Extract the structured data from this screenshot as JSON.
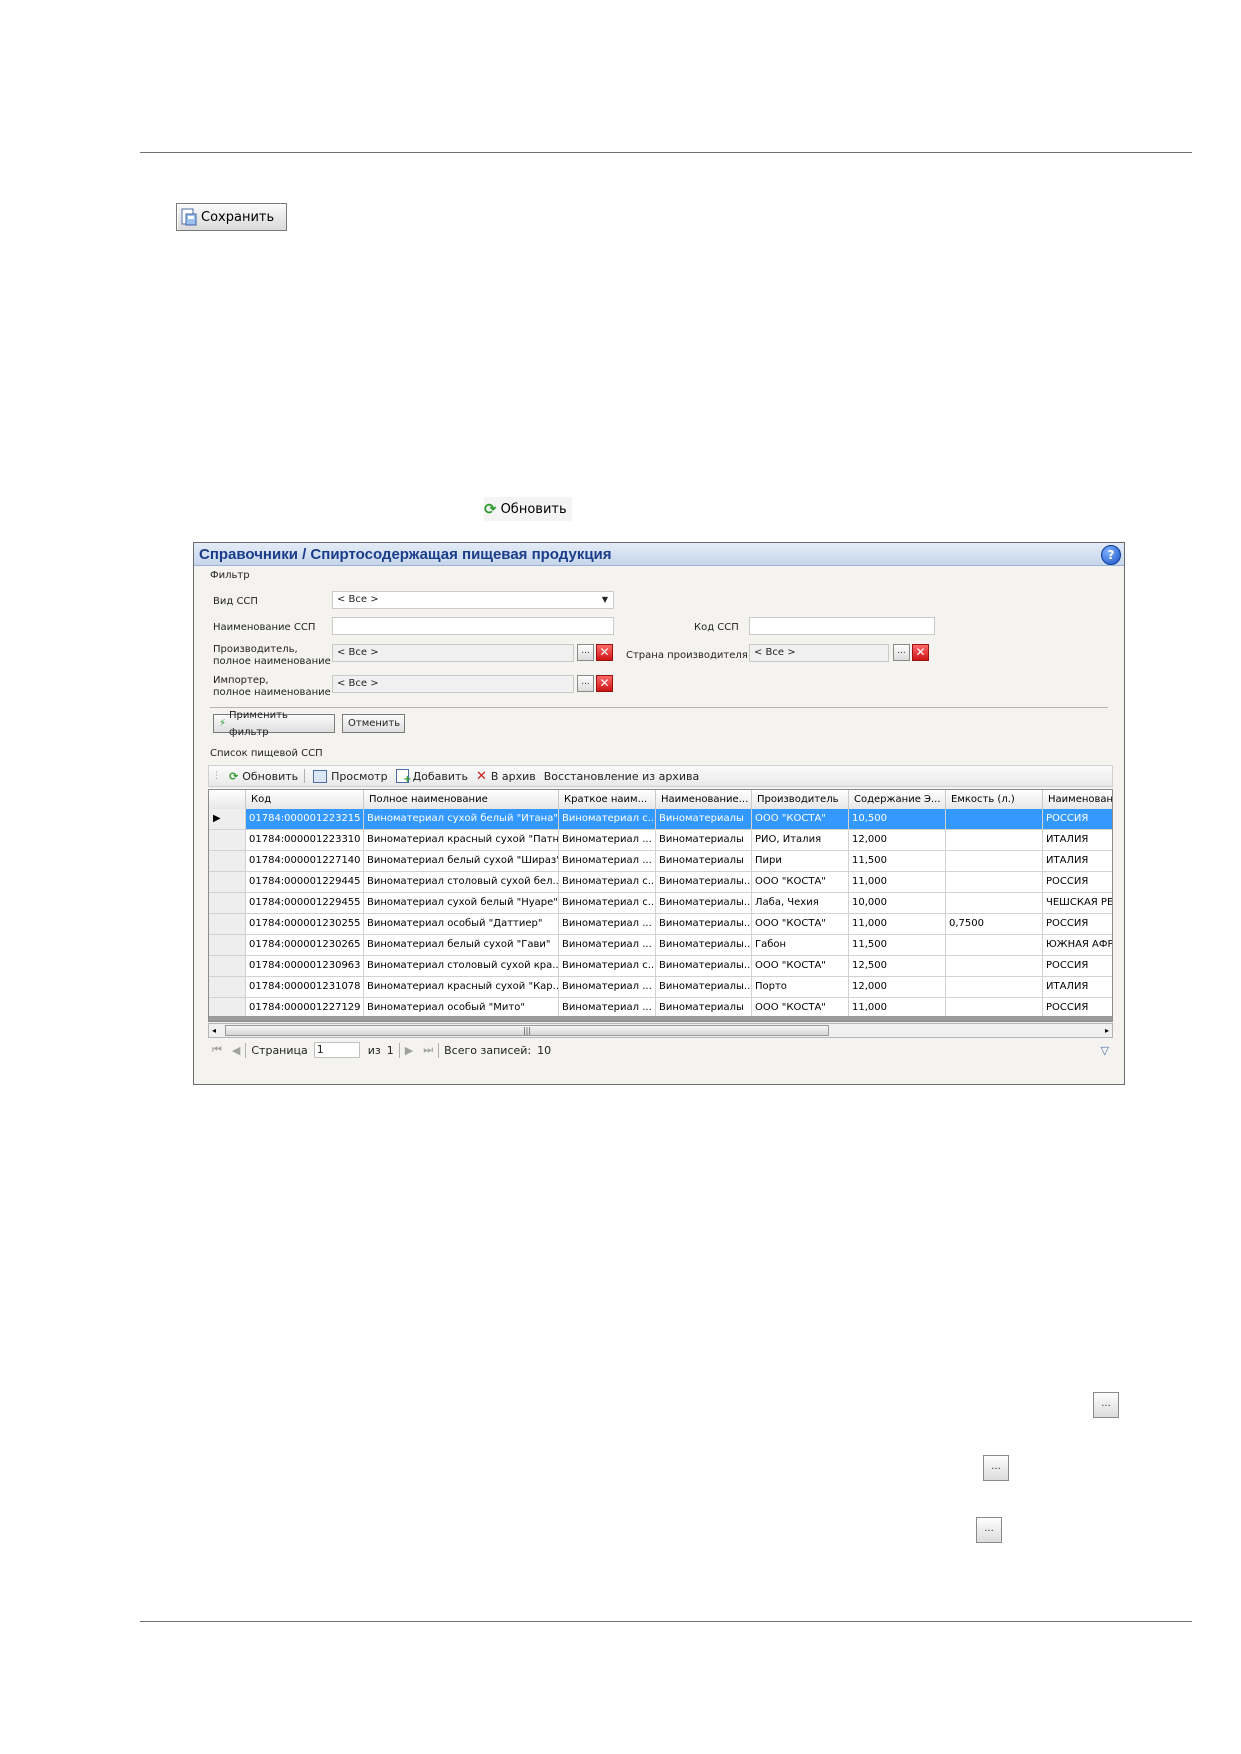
{
  "top_toolbar": {
    "save_label": "Сохранить",
    "refresh_label": "Обновить"
  },
  "window": {
    "title": "Справочники / Спиртосодержащая пищевая продукция",
    "filter": {
      "group_label": "Фильтр",
      "vid_label": "Вид ССП",
      "vid_value": "< Все >",
      "name_label": "Наименование ССП",
      "code_label": "Код ССП",
      "producer_label_1": "Производитель,",
      "producer_label_2": "полное наименование",
      "producer_value": "< Все >",
      "country_label": "Страна производителя",
      "country_value": "< Все >",
      "importer_label_1": "Импортер,",
      "importer_label_2": "полное наименование",
      "importer_value": "< Все >",
      "apply_label": "Применить фильтр",
      "cancel_label": "Отменить"
    },
    "list": {
      "group_label": "Список пищевой ССП",
      "toolbar": {
        "refresh": "Обновить",
        "view": "Просмотр",
        "add": "Добавить",
        "archive": "В архив",
        "restore": "Восстановление из архива"
      },
      "columns": [
        "Код",
        "Полное наименование",
        "Краткое наим...",
        "Наименование...",
        "Производитель",
        "Содержание Э...",
        "Емкость (л.)",
        "Наименование"
      ],
      "rows": [
        [
          "01784:000001223215",
          "Виноматериал сухой белый \"Итана\"",
          "Виноматериал с...",
          "Виноматериалы",
          "ООО \"КОСТА\"",
          "10,500",
          "",
          "РОССИЯ"
        ],
        [
          "01784:000001223310",
          "Виноматериал красный сухой \"Патна\"",
          "Виноматериал ...",
          "Виноматериалы",
          "РИО, Италия",
          "12,000",
          "",
          "ИТАЛИЯ"
        ],
        [
          "01784:000001227140",
          "Виноматериал белый сухой \"Шираз\"",
          "Виноматериал ...",
          "Виноматериалы",
          "Пири",
          "11,500",
          "",
          "ИТАЛИЯ"
        ],
        [
          "01784:000001229445",
          "Виноматериал столовый сухой бел...",
          "Виноматериал с...",
          "Виноматериалы...",
          "ООО \"КОСТА\"",
          "11,000",
          "",
          "РОССИЯ"
        ],
        [
          "01784:000001229455",
          "Виноматериал сухой белый \"Нуаре\"",
          "Виноматериал с...",
          "Виноматериалы...",
          "Лаба, Чехия",
          "10,000",
          "",
          "ЧЕШСКАЯ РЕСП"
        ],
        [
          "01784:000001230255",
          "Виноматериал особый \"Даттиер\"",
          "Виноматериал ...",
          "Виноматериалы...",
          "ООО \"КОСТА\"",
          "11,000",
          "0,7500",
          "РОССИЯ"
        ],
        [
          "01784:000001230265",
          "Виноматериал белый сухой \"Гави\"",
          "Виноматериал ...",
          "Виноматериалы...",
          "Габон",
          "11,500",
          "",
          "ЮЖНАЯ АФРИК"
        ],
        [
          "01784:000001230963",
          "Виноматериал столовый сухой кра...",
          "Виноматериал с...",
          "Виноматериалы...",
          "ООО \"КОСТА\"",
          "12,500",
          "",
          "РОССИЯ"
        ],
        [
          "01784:000001231078",
          "Виноматериал красный сухой \"Кар...",
          "Виноматериал ...",
          "Виноматериалы...",
          "Порто",
          "12,000",
          "",
          "ИТАЛИЯ"
        ],
        [
          "01784:000001227129",
          "Виноматериал особый \"Мито\"",
          "Виноматериал ...",
          "Виноматериалы",
          "ООО \"КОСТА\"",
          "11,000",
          "",
          "РОССИЯ"
        ]
      ]
    },
    "pager": {
      "page_label": "Страница",
      "page_value": "1",
      "of_label": "из",
      "of_value": "1",
      "total_label": "Всего записей:",
      "total_value": "10"
    }
  },
  "misc_buttons": {
    "dots_label": "..."
  }
}
